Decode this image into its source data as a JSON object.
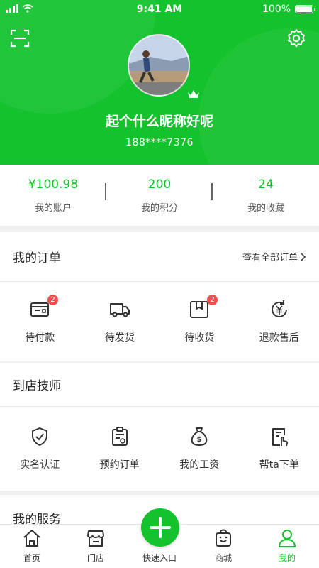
{
  "status_bar": {
    "time": "9:41 AM",
    "battery": "100%"
  },
  "profile": {
    "nickname": "起个什么昵称好呢",
    "phone": "188****7376"
  },
  "stats": [
    {
      "value": "¥100.98",
      "label": "我的账户"
    },
    {
      "value": "200",
      "label": "我的积分"
    },
    {
      "value": "24",
      "label": "我的收藏"
    }
  ],
  "orders": {
    "title": "我的订单",
    "view_all": "查看全部订单",
    "items": [
      {
        "label": "待付款",
        "icon": "wallet-icon",
        "badge": "2"
      },
      {
        "label": "待发货",
        "icon": "truck-icon"
      },
      {
        "label": "待收货",
        "icon": "package-icon",
        "badge": "2"
      },
      {
        "label": "退款售后",
        "icon": "refund-icon"
      }
    ]
  },
  "technician": {
    "title": "到店技师",
    "items": [
      {
        "label": "实名认证",
        "icon": "shield-check-icon"
      },
      {
        "label": "预约订单",
        "icon": "clipboard-icon"
      },
      {
        "label": "我的工资",
        "icon": "money-bag-icon"
      },
      {
        "label": "帮ta下单",
        "icon": "order-hand-icon"
      }
    ]
  },
  "services": {
    "title": "我的服务"
  },
  "tabbar": [
    {
      "label": "首页",
      "icon": "home-icon"
    },
    {
      "label": "门店",
      "icon": "store-icon"
    },
    {
      "label": "快速入口",
      "icon": "plus-icon"
    },
    {
      "label": "商城",
      "icon": "shopping-bag-icon"
    },
    {
      "label": "我的",
      "icon": "user-icon",
      "active": true
    }
  ],
  "colors": {
    "primary": "#13c22d",
    "badge": "#ef4f4f"
  }
}
